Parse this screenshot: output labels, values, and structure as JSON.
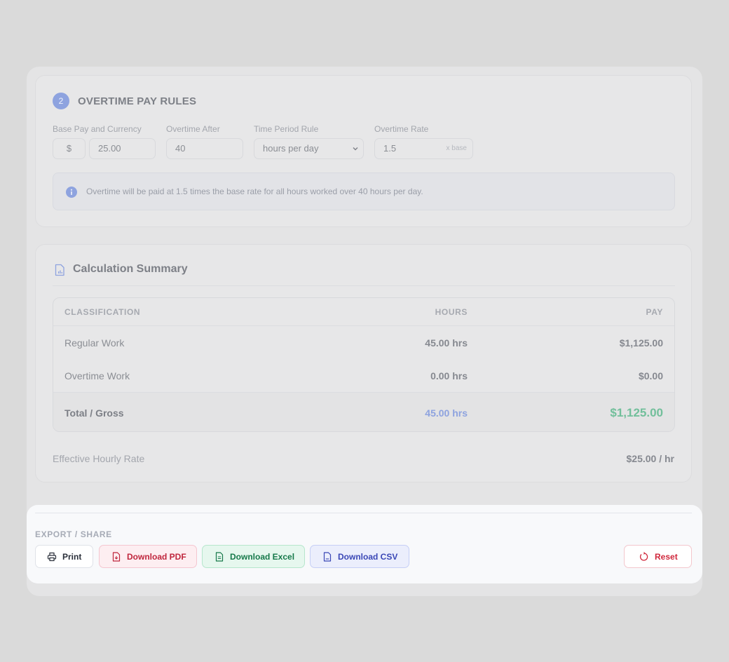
{
  "rules": {
    "step": "2",
    "title": "OVERTIME PAY RULES",
    "base_pay_label": "Base Pay and Currency",
    "currency": "$",
    "base_pay": "25.00",
    "overtime_after_label": "Overtime After",
    "overtime_after": "40",
    "period_label": "Time Period Rule",
    "period_value": "hours per day",
    "rate_label": "Overtime Rate",
    "rate_value": "1.5",
    "rate_suffix": "x base",
    "info_text": "Overtime will be paid at 1.5 times the base rate for all hours worked over 40 hours per day."
  },
  "summary": {
    "title": "Calculation Summary",
    "columns": [
      "CLASSIFICATION",
      "HOURS",
      "PAY"
    ],
    "rows": [
      {
        "label": "Regular Work",
        "hours": "45.00 hrs",
        "pay": "$1,125.00"
      },
      {
        "label": "Overtime Work",
        "hours": "0.00 hrs",
        "pay": "$0.00"
      }
    ],
    "total": {
      "label": "Total / Gross",
      "hours": "45.00 hrs",
      "pay": "$1,125.00"
    },
    "effective_label": "Effective Hourly Rate",
    "effective_value": "$25.00 / hr"
  },
  "export": {
    "label": "EXPORT / SHARE",
    "print": "Print",
    "pdf": "Download PDF",
    "excel": "Download Excel",
    "csv": "Download CSV",
    "reset": "Reset"
  },
  "colors": {
    "accent": "#8ea3df",
    "total_pay": "#72bf9b",
    "pdf": "#c0263d",
    "excel": "#16794a",
    "csv": "#3a47b6",
    "reset": "#d0283c"
  },
  "icons": [
    "info-icon",
    "document-chart-icon",
    "printer-icon",
    "pdf-file-icon",
    "excel-file-icon",
    "csv-file-icon",
    "reset-icon",
    "chevron-down-icon"
  ]
}
